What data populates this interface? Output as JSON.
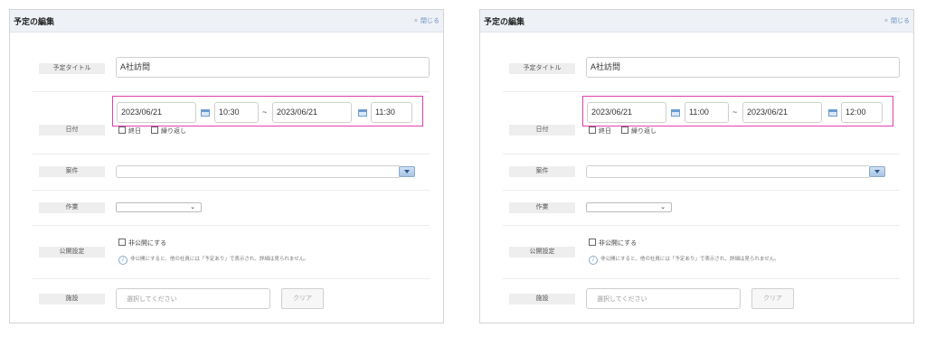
{
  "panels": [
    {
      "title": "予定の編集",
      "close_icon": "×",
      "close_label": "閉じる",
      "fields": {
        "title_label": "予定タイトル",
        "title_value": "A社訪問",
        "date_label": "日付",
        "start_date": "2023/06/21",
        "start_time": "10:30",
        "range_sep": "~",
        "end_date": "2023/06/21",
        "end_time": "11:30",
        "allday_label": "終日",
        "repeat_label": "繰り返し",
        "project_label": "案件",
        "project_value": "",
        "work_label": "作業",
        "work_value": "",
        "visibility_label": "公開設定",
        "private_label": "非公開にする",
        "private_note": "非公開にすると、他の社員には「予定あり」で表示され、詳細は見られません。",
        "facility_label": "施設",
        "facility_placeholder": "選択してください",
        "clear_label": "クリア"
      }
    },
    {
      "title": "予定の編集",
      "close_icon": "×",
      "close_label": "閉じる",
      "fields": {
        "title_label": "予定タイトル",
        "title_value": "A社訪問",
        "date_label": "日付",
        "start_date": "2023/06/21",
        "start_time": "11:00",
        "range_sep": "~",
        "end_date": "2023/06/21",
        "end_time": "12:00",
        "allday_label": "終日",
        "repeat_label": "繰り返し",
        "project_label": "案件",
        "project_value": "",
        "work_label": "作業",
        "work_value": "",
        "visibility_label": "公開設定",
        "private_label": "非公開にする",
        "private_note": "非公開にすると、他の社員には「予定あり」で表示され、詳細は見られません。",
        "facility_label": "施設",
        "facility_placeholder": "選択してください",
        "clear_label": "クリア"
      }
    }
  ],
  "colors": {
    "highlight": "#e23fb0",
    "titlebar_bg": "#eef2f7",
    "link": "#6a8fc0"
  }
}
